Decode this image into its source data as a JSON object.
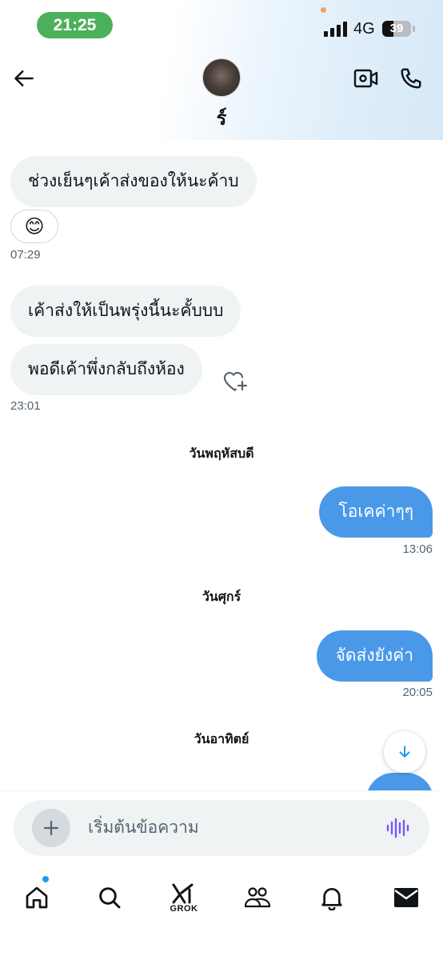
{
  "status_bar": {
    "time": "21:25",
    "network": "4G",
    "battery": "39",
    "battery_level": 0.39
  },
  "header": {
    "back_icon": "arrow-left-icon",
    "contact_name": "ร์",
    "video_call_icon": "video-camera-icon",
    "voice_call_icon": "phone-icon"
  },
  "conversation": {
    "messages": [
      {
        "side": "in",
        "text": "ช่วงเย็นๆเค้าส่งของให้นะค้าบ"
      },
      {
        "side": "in",
        "reaction": "😊",
        "timestamp": "07:29"
      },
      {
        "side": "in",
        "text": "เค้าส่งให้เป็นพรุ่งนี้นะคั้บบบ"
      },
      {
        "side": "in",
        "text": "พอดีเค้าพึ่งกลับถึงห้อง",
        "timestamp": "23:01",
        "react_icon": "heart-plus-icon"
      },
      {
        "day_separator": "วันพฤหัสบดี"
      },
      {
        "side": "out",
        "text": "โอเคค่าๆๆ",
        "timestamp": "13:06"
      },
      {
        "day_separator": "วันศุกร์"
      },
      {
        "side": "out",
        "text": "จัดส่งยังค่า",
        "timestamp": "20:05"
      },
      {
        "day_separator": "วันอาทิตย์"
      }
    ]
  },
  "composer": {
    "placeholder": "เริ่มต้นข้อความ",
    "add_icon": "plus-icon",
    "voice_icon": "voice-wave-icon"
  },
  "bottom_nav": {
    "items": [
      {
        "icon": "home-icon",
        "has_notification_dot": true
      },
      {
        "icon": "search-icon"
      },
      {
        "icon": "grok-icon",
        "label": "GROK"
      },
      {
        "icon": "communities-icon"
      },
      {
        "icon": "bell-icon"
      },
      {
        "icon": "mail-icon",
        "active": true
      }
    ]
  },
  "colors": {
    "accent": "#1d9bf0",
    "outgoing_bubble": "#4a99e9",
    "incoming_bubble": "#eff3f4",
    "time_pill": "#4cb05a"
  }
}
